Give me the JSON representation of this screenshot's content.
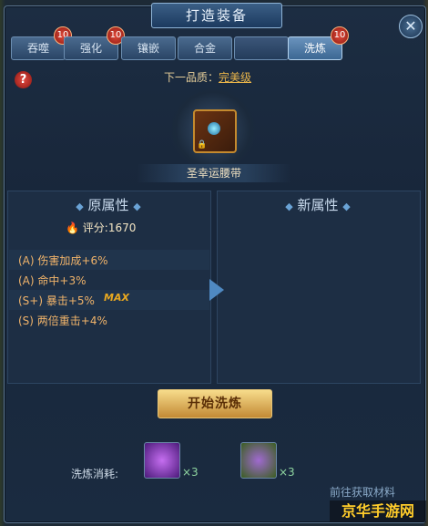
{
  "window": {
    "title": "打造装备",
    "close_icon": "close-icon"
  },
  "tabs": [
    {
      "label": "吞噬",
      "badge": "10",
      "active": false
    },
    {
      "label": "强化",
      "badge": "10",
      "active": false
    },
    {
      "label": "镶嵌",
      "badge": "",
      "active": false
    },
    {
      "label": "合金",
      "badge": "",
      "active": false
    },
    {
      "label": "",
      "badge": "",
      "active": false
    },
    {
      "label": "洗炼",
      "badge": "10",
      "active": true
    }
  ],
  "quality": {
    "label": "下一品质：",
    "value": "完美级"
  },
  "item": {
    "name": "圣幸运腰带",
    "icon": "belt-icon",
    "locked": true
  },
  "original": {
    "header": "原属性",
    "score_label": "评分:",
    "score_value": "1670",
    "attributes": [
      {
        "text": "(A) 伤害加成+6%"
      },
      {
        "text": "(A) 命中+3%"
      },
      {
        "text": "(S+) 暴击+5%"
      },
      {
        "text": "(S) 两倍重击+4%"
      }
    ],
    "max_tag": "MAX"
  },
  "new_attrs": {
    "header": "新属性"
  },
  "start_button": "开始洗炼",
  "cost": {
    "label": "洗炼消耗:",
    "materials": [
      {
        "icon": "purple-crystal-icon",
        "count": "×3"
      },
      {
        "icon": "purple-ore-icon",
        "count": "×3"
      }
    ]
  },
  "get_more": "前往获取材料",
  "watermark": "京华手游网",
  "colors": {
    "accent": "#e8b44a",
    "attr": "#f0b36a",
    "button": "#f7dc8b"
  }
}
